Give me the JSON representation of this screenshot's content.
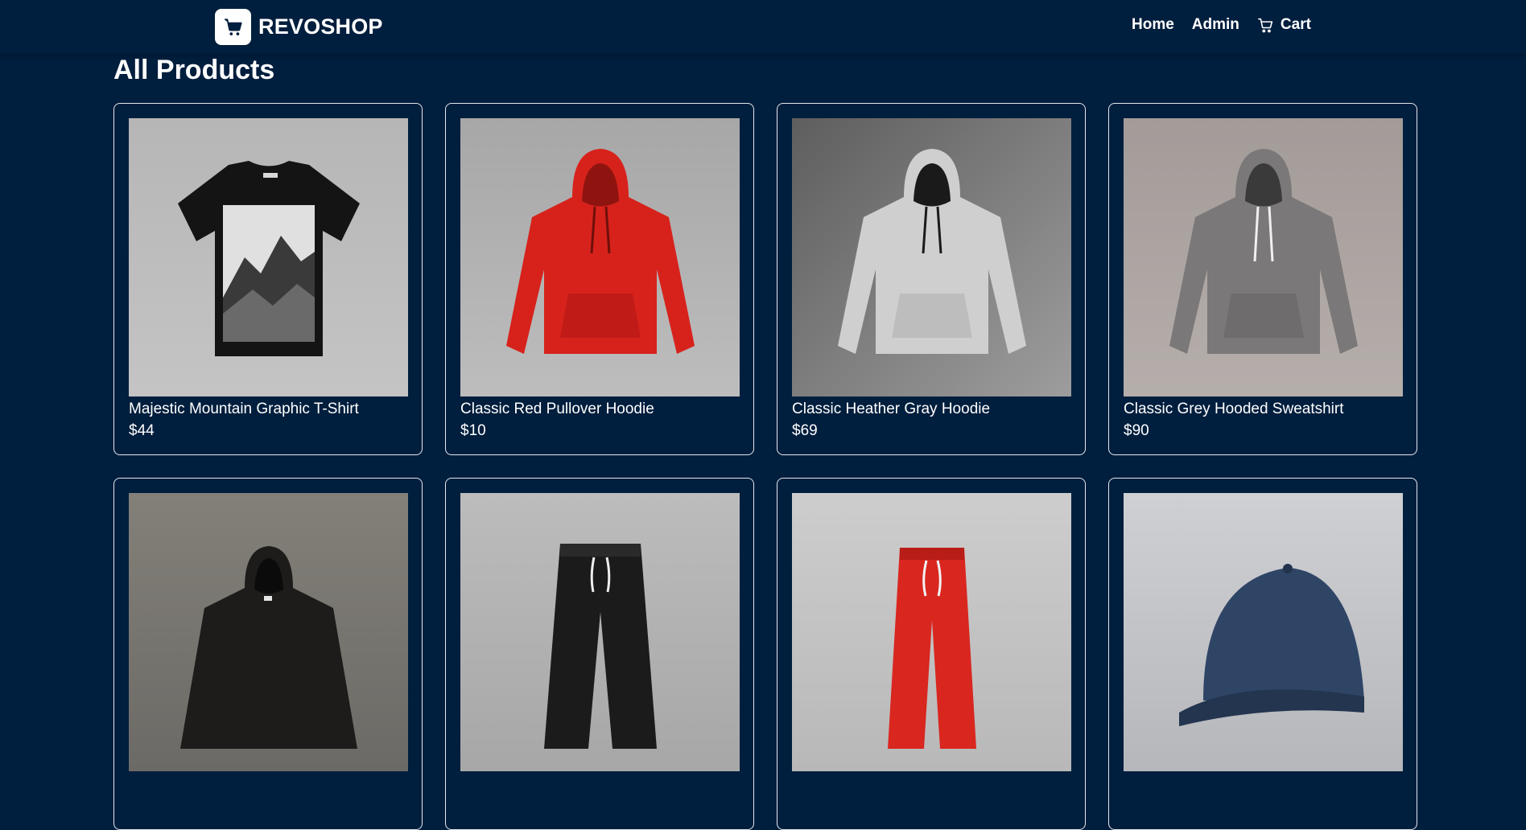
{
  "brand": {
    "name": "REVOSHOP",
    "icon": "cart-icon"
  },
  "nav": [
    {
      "label": "Home"
    },
    {
      "label": "Admin"
    },
    {
      "label": "Cart",
      "icon": "cart-icon"
    }
  ],
  "page": {
    "title": "All Products"
  },
  "products": [
    {
      "name": "Majestic Mountain Graphic T-Shirt",
      "price": "$44"
    },
    {
      "name": "Classic Red Pullover Hoodie",
      "price": "$10"
    },
    {
      "name": "Classic Heather Gray Hoodie",
      "price": "$69"
    },
    {
      "name": "Classic Grey Hooded Sweatshirt",
      "price": "$90"
    },
    {
      "name": "",
      "price": ""
    },
    {
      "name": "",
      "price": ""
    },
    {
      "name": "",
      "price": ""
    },
    {
      "name": "",
      "price": ""
    }
  ],
  "colors": {
    "background": "#001e3d",
    "text": "#ffffff",
    "card_border": "#e6e9ef"
  }
}
